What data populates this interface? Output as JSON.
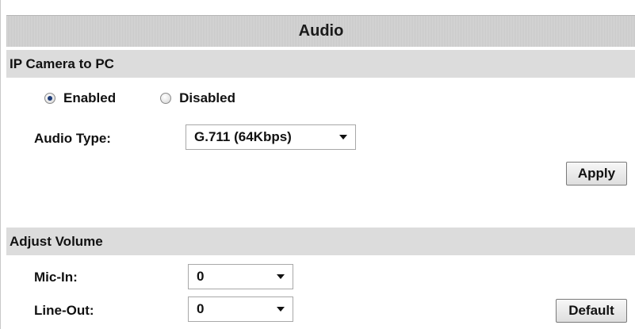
{
  "page": {
    "title": "Audio"
  },
  "camera_to_pc": {
    "heading": "IP Camera to PC",
    "enabled_label": "Enabled",
    "disabled_label": "Disabled",
    "selected": "Enabled",
    "audio_type_label": "Audio Type:",
    "audio_type_value": "G.711 (64Kbps)",
    "apply_label": "Apply"
  },
  "volume": {
    "heading": "Adjust Volume",
    "mic_in_label": "Mic-In:",
    "mic_in_value": "0",
    "line_out_label": "Line-Out:",
    "line_out_value": "0",
    "default_label": "Default"
  },
  "icons": {
    "dropdown": "chevron-down-icon"
  },
  "colors": {
    "title_bar": "#d0d0d0",
    "section_bar": "#dcdcdc",
    "radio_selected": "#1e3c78"
  }
}
